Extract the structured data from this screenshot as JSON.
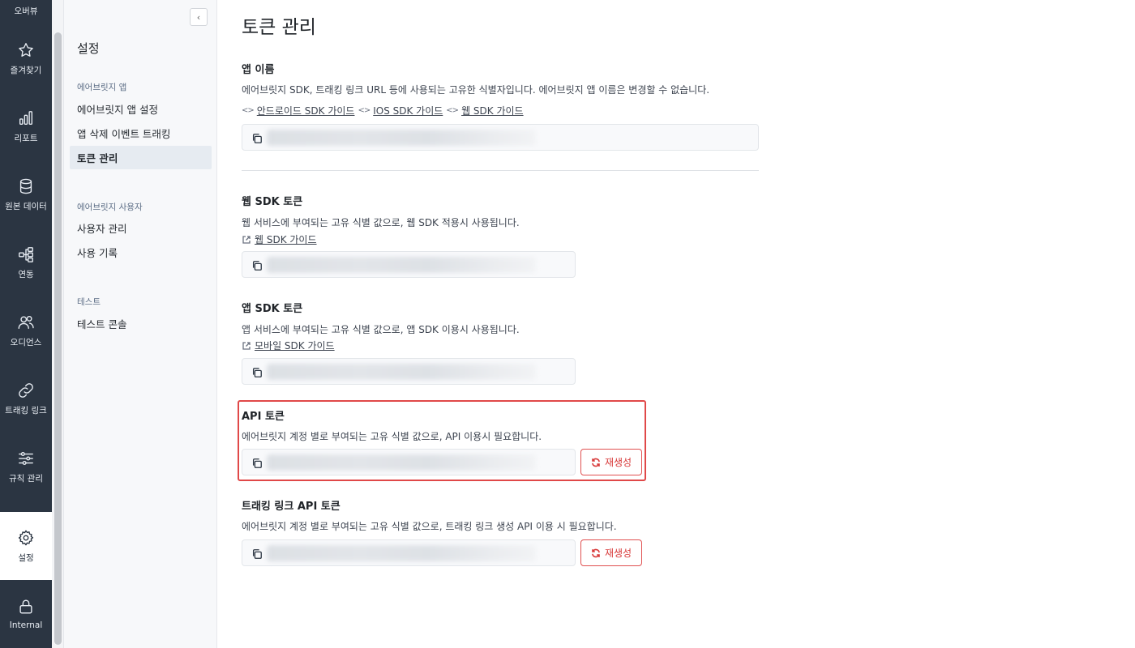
{
  "rail": {
    "top_partial": "오버뷰",
    "items": [
      {
        "label": "즐겨찾기",
        "icon": "star-icon"
      },
      {
        "label": "리포트",
        "icon": "bar-chart-icon"
      },
      {
        "label": "원본 데이터",
        "icon": "database-icon"
      },
      {
        "label": "연동",
        "icon": "flow-icon"
      },
      {
        "label": "오디언스",
        "icon": "users-icon"
      },
      {
        "label": "트래킹 링크",
        "icon": "link-icon"
      },
      {
        "label": "규칙 관리",
        "icon": "sliders-icon"
      },
      {
        "label": "설정",
        "icon": "gear-icon",
        "active": true
      },
      {
        "label": "Internal",
        "icon": "lock-icon"
      }
    ]
  },
  "subnav": {
    "collapse_label": "‹",
    "title": "설정",
    "groups": [
      {
        "label": "에어브릿지 앱",
        "items": [
          "에어브릿지 앱 설정",
          "앱 삭제 이벤트 트래킹",
          "토큰 관리"
        ]
      },
      {
        "label": "에어브릿지 사용자",
        "items": [
          "사용자 관리",
          "사용 기록"
        ]
      },
      {
        "label": "테스트",
        "items": [
          "테스트 콘솔"
        ]
      }
    ],
    "active_item": "토큰 관리"
  },
  "main": {
    "page_title": "토큰 관리",
    "app_name": {
      "title": "앱 이름",
      "desc": "에어브릿지 SDK, 트래킹 링크 URL 등에 사용되는 고유한 식별자입니다. 에어브릿지 앱 이름은 변경할 수 없습니다.",
      "links": [
        "안드로이드 SDK 가이드",
        "IOS SDK 가이드",
        "웹 SDK 가이드"
      ]
    },
    "web_sdk_token": {
      "title": "웹 SDK 토큰",
      "desc": "웹 서비스에 부여되는 고유 식별 값으로, 웹 SDK 적용시 사용됩니다.",
      "link": "웹 SDK 가이드"
    },
    "app_sdk_token": {
      "title": "앱 SDK 토큰",
      "desc": "앱 서비스에 부여되는 고유 식별 값으로, 앱 SDK 이용시 사용됩니다.",
      "link": "모바일 SDK 가이드"
    },
    "api_token": {
      "title": "API 토큰",
      "desc": "에어브릿지 계정 별로 부여되는 고유 식별 값으로, API 이용시 필요합니다.",
      "regen_label": "재생성"
    },
    "tracking_link_api_token": {
      "title": "트래킹 링크 API 토큰",
      "desc": "에어브릿지 계정 별로 부여되는 고유 식별 값으로, 트래킹 링크 생성 API 이용 시 필요합니다.",
      "regen_label": "재생성"
    }
  },
  "colors": {
    "rail_bg": "#2b3542",
    "accent_red": "#d83a3a",
    "highlight_border": "#e04848"
  }
}
